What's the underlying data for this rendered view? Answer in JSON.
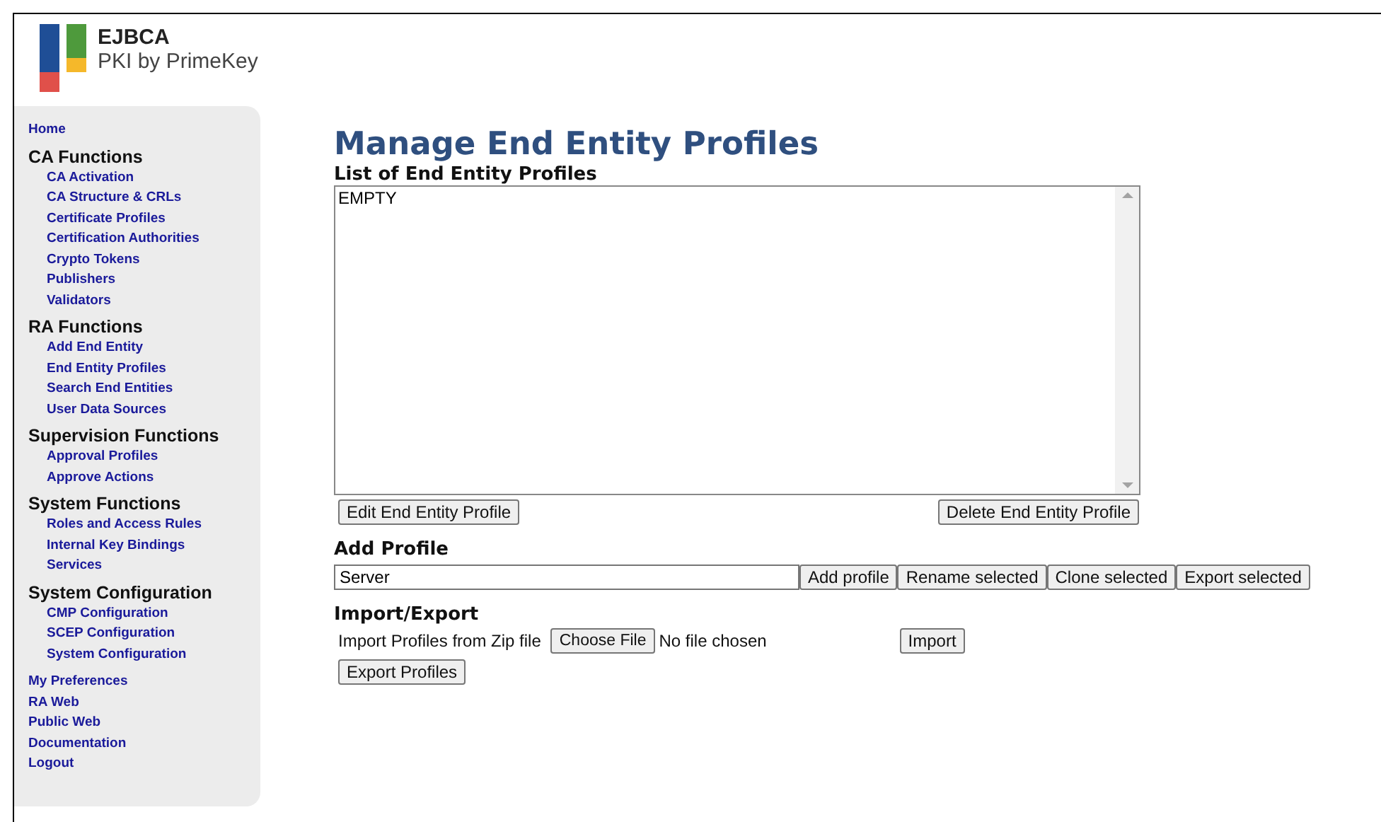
{
  "logo": {
    "name": "EJBCA",
    "tagline": "PKI by PrimeKey"
  },
  "sidebar": {
    "items": [
      {
        "kind": "link",
        "label": "Home"
      },
      {
        "kind": "section",
        "label": "CA Functions",
        "children": [
          {
            "label": "CA Activation"
          },
          {
            "label": "CA Structure & CRLs"
          },
          {
            "label": "Certificate Profiles"
          },
          {
            "label": "Certification Authorities"
          },
          {
            "label": "Crypto Tokens"
          },
          {
            "label": "Publishers"
          },
          {
            "label": "Validators"
          }
        ]
      },
      {
        "kind": "section",
        "label": "RA Functions",
        "children": [
          {
            "label": "Add End Entity"
          },
          {
            "label": "End Entity Profiles"
          },
          {
            "label": "Search End Entities"
          },
          {
            "label": "User Data Sources"
          }
        ]
      },
      {
        "kind": "section",
        "label": "Supervision Functions",
        "children": [
          {
            "label": "Approval Profiles"
          },
          {
            "label": "Approve Actions"
          }
        ]
      },
      {
        "kind": "section",
        "label": "System Functions",
        "children": [
          {
            "label": "Roles and Access Rules"
          },
          {
            "label": "Internal Key Bindings"
          },
          {
            "label": "Services"
          }
        ]
      },
      {
        "kind": "section",
        "label": "System Configuration",
        "children": [
          {
            "label": "CMP Configuration"
          },
          {
            "label": "SCEP Configuration"
          },
          {
            "label": "System Configuration"
          }
        ]
      },
      {
        "kind": "link",
        "label": "My Preferences"
      },
      {
        "kind": "link",
        "label": "RA Web"
      },
      {
        "kind": "link",
        "label": "Public Web"
      },
      {
        "kind": "link",
        "label": "Documentation"
      },
      {
        "kind": "link",
        "label": "Logout"
      }
    ]
  },
  "page_title": "Manage End Entity Profiles",
  "profile_list": {
    "heading": "List of End Entity Profiles",
    "items": [
      "EMPTY"
    ],
    "buttons": [
      "Edit End Entity Profile",
      "Delete End Entity Profile"
    ]
  },
  "add_profile": {
    "heading": "Add Profile",
    "value": "Server",
    "buttons": [
      "Add profile",
      "Rename selected",
      "Clone selected",
      "Export selected"
    ]
  },
  "import_export": {
    "heading": "Import/Export",
    "label": "Import Profiles from Zip file",
    "file_button": "Choose File",
    "file_status": "No file chosen",
    "import_button": "Import",
    "export_button": "Export Profiles"
  }
}
